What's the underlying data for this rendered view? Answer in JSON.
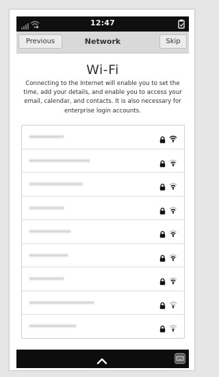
{
  "status_bar": {
    "time": "12:47",
    "signal_icon": "cellular-signal-icon",
    "wifi_icon": "wifi-off-icon",
    "clipboard_icon": "clipboard-icon"
  },
  "header": {
    "title": "Network",
    "previous_label": "Previous",
    "skip_label": "Skip"
  },
  "main": {
    "heading": "Wi-Fi",
    "description": "Connecting to the Internet will enable you to set the time, add your details, and enable you to access your email, calendar, and contacts. It is also necessary for enterprise login accounts."
  },
  "networks": [
    {
      "name": "",
      "secured": true,
      "signal": 4
    },
    {
      "name": "",
      "secured": true,
      "signal": 3
    },
    {
      "name": "",
      "secured": true,
      "signal": 3
    },
    {
      "name": "",
      "secured": true,
      "signal": 3
    },
    {
      "name": "",
      "secured": true,
      "signal": 3
    },
    {
      "name": "",
      "secured": true,
      "signal": 3
    },
    {
      "name": "",
      "secured": true,
      "signal": 3
    },
    {
      "name": "",
      "secured": true,
      "signal": 2
    },
    {
      "name": "",
      "secured": true,
      "signal": 2
    }
  ],
  "bottom_bar": {
    "up_icon": "chevron-up-icon",
    "keyboard_icon": "keyboard-icon"
  },
  "colors": {
    "status_bar": "#0f0f0f",
    "header": "#d9d9d9",
    "text": "#333333"
  }
}
